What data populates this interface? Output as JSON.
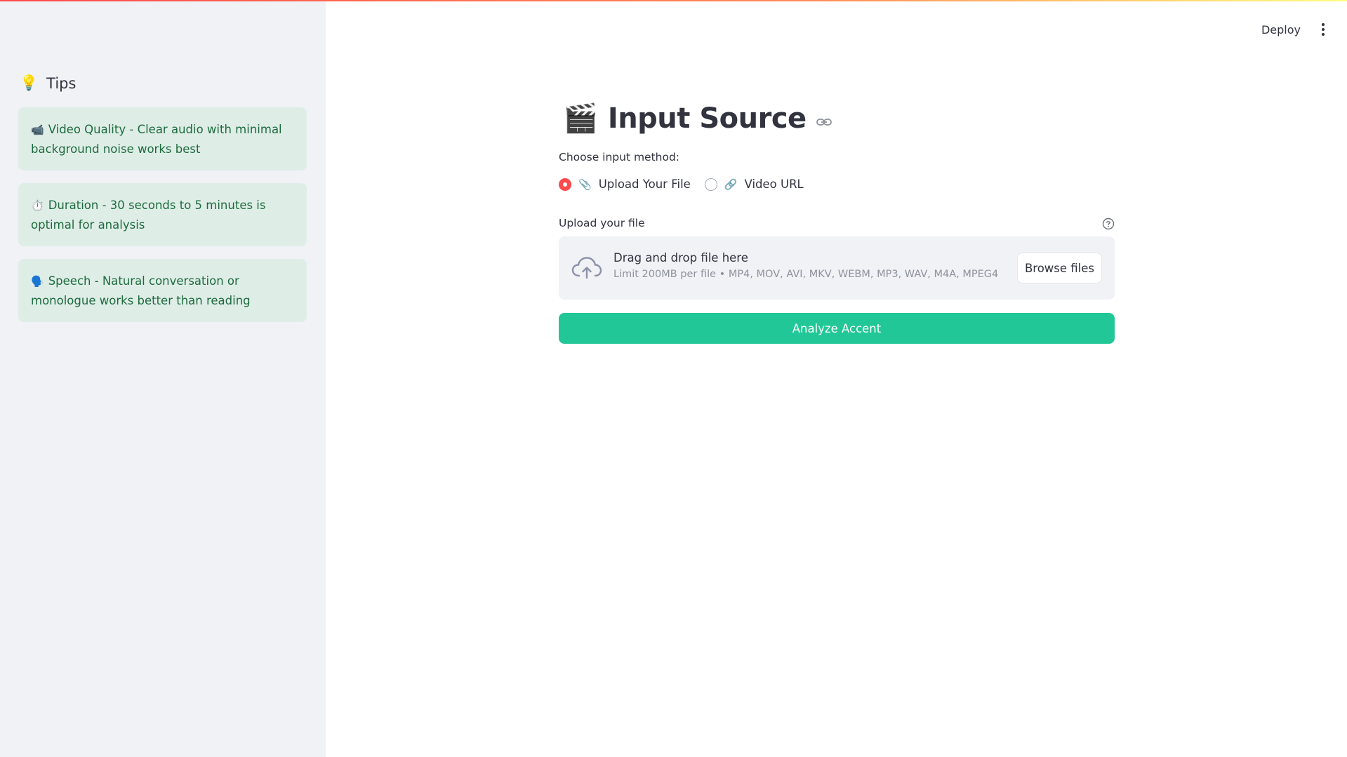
{
  "sidebar": {
    "tips_header": {
      "icon": "lightbulb-icon",
      "emoji": "💡",
      "title": "Tips"
    },
    "tips": [
      {
        "icon": "video-camera-icon",
        "emoji": "📹",
        "text": "Video Quality - Clear audio with minimal background noise works best"
      },
      {
        "icon": "stopwatch-icon",
        "emoji": "⏱️",
        "text": "Duration - 30 seconds to 5 minutes is optimal for analysis"
      },
      {
        "icon": "speaking-head-icon",
        "emoji": "🗣️",
        "text": "Speech - Natural conversation or monologue works better than reading"
      }
    ]
  },
  "header": {
    "deploy_label": "Deploy"
  },
  "main": {
    "title": {
      "emoji": "🎬",
      "text": "Input Source"
    },
    "input_method": {
      "label": "Choose input method:",
      "options": [
        {
          "emoji": "📎",
          "label": "Upload Your File",
          "checked": true
        },
        {
          "emoji": "🔗",
          "label": "Video URL",
          "checked": false
        }
      ]
    },
    "uploader": {
      "label": "Upload your file",
      "drag_text": "Drag and drop file here",
      "limit_text": "Limit 200MB per file • MP4, MOV, AVI, MKV, WEBM, MP3, WAV, M4A, MPEG4",
      "browse_label": "Browse files"
    },
    "analyze_label": "Analyze Accent"
  },
  "colors": {
    "accent": "#ff4b4b",
    "primary_button": "#21c796",
    "tip_background": "#dfede7",
    "tip_text": "#1d6b3e",
    "sidebar_background": "#f0f2f6"
  }
}
